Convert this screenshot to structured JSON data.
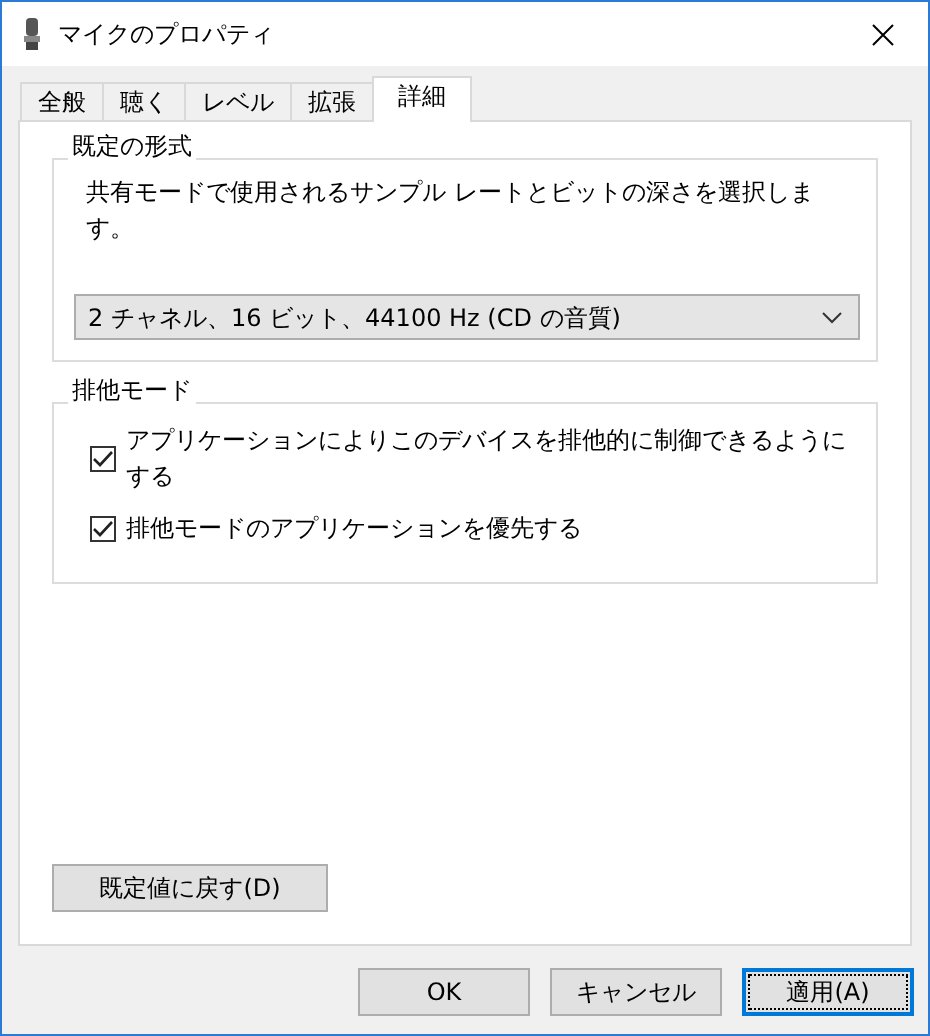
{
  "window": {
    "title": "マイクのプロパティ"
  },
  "tabs": [
    {
      "label": "全般",
      "selected": false
    },
    {
      "label": "聴く",
      "selected": false
    },
    {
      "label": "レベル",
      "selected": false
    },
    {
      "label": "拡張",
      "selected": false
    },
    {
      "label": "詳細",
      "selected": true
    }
  ],
  "default_format": {
    "title": "既定の形式",
    "description": "共有モードで使用されるサンプル レートとビットの深さを選択します。",
    "value": "2 チャネル、16 ビット、44100 Hz (CD の音質)"
  },
  "exclusive_mode": {
    "title": "排他モード",
    "options": [
      {
        "label": "アプリケーションによりこのデバイスを排他的に制御できるようにする",
        "checked": true
      },
      {
        "label": "排他モードのアプリケーションを優先する",
        "checked": true
      }
    ]
  },
  "restore_button": "既定値に戻す(D)",
  "buttons": [
    {
      "label": "OK",
      "focused": false
    },
    {
      "label": "キャンセル",
      "focused": false
    },
    {
      "label": "適用(A)",
      "focused": true
    }
  ]
}
